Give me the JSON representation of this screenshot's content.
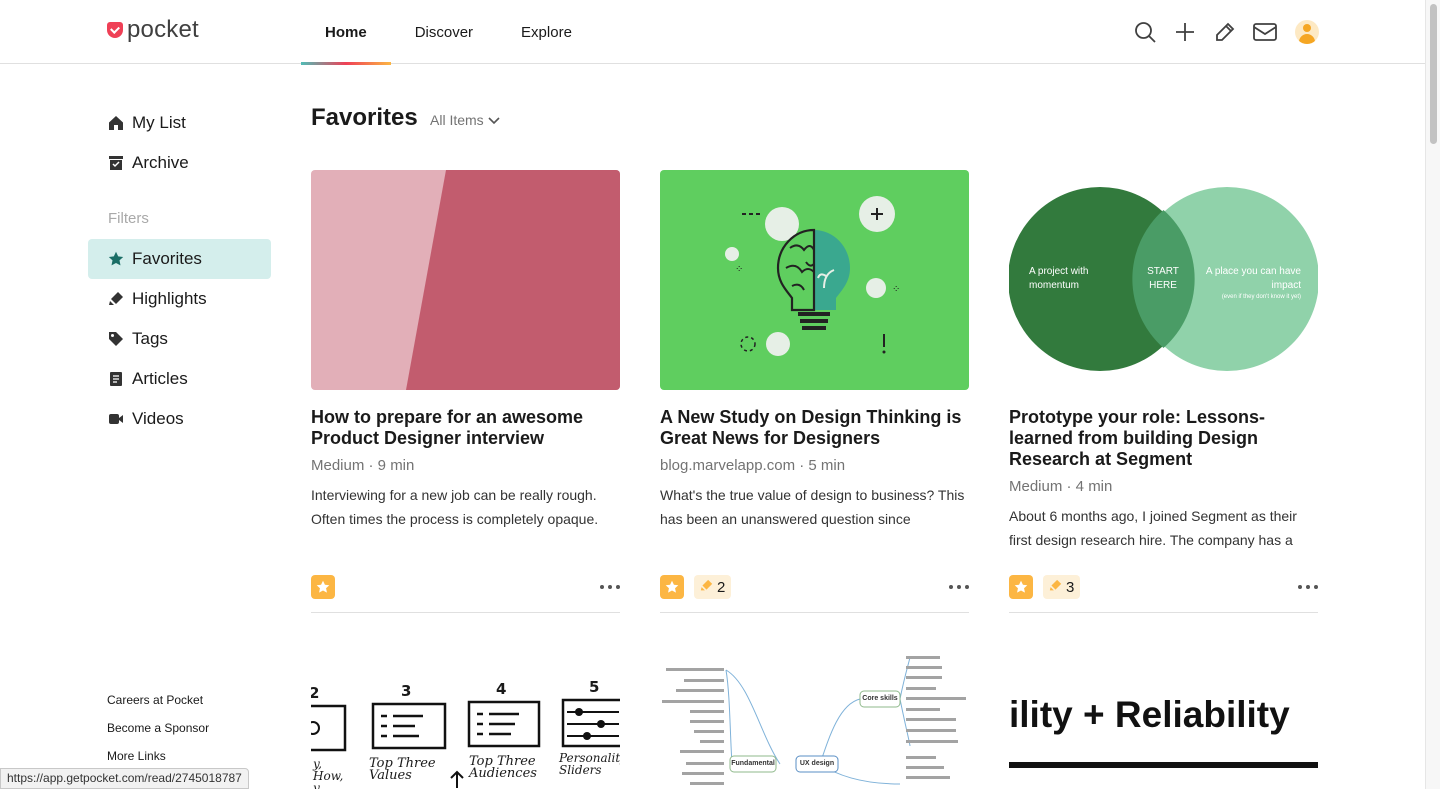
{
  "app": {
    "logo_text": "pocket",
    "brand_color": "#ef4056",
    "accent_color": "#50bcb6"
  },
  "nav": {
    "tabs": [
      {
        "label": "Home",
        "active": true
      },
      {
        "label": "Discover",
        "active": false
      },
      {
        "label": "Explore",
        "active": false
      }
    ]
  },
  "header_icons": [
    "search-icon",
    "add-icon",
    "pencil-icon",
    "inbox-icon",
    "avatar"
  ],
  "sidebar": {
    "items": [
      {
        "label": "My List",
        "icon": "home-icon"
      },
      {
        "label": "Archive",
        "icon": "archive-icon"
      }
    ],
    "filters_heading": "Filters",
    "filters": [
      {
        "label": "Favorites",
        "icon": "star-icon",
        "active": true
      },
      {
        "label": "Highlights",
        "icon": "highlighter-icon"
      },
      {
        "label": "Tags",
        "icon": "tag-icon"
      },
      {
        "label": "Articles",
        "icon": "article-icon"
      },
      {
        "label": "Videos",
        "icon": "video-icon"
      }
    ],
    "footer_links": [
      "Careers at Pocket",
      "Become a Sponsor",
      "More Links"
    ]
  },
  "main": {
    "title": "Favorites",
    "filter_label": "All Items",
    "cards": [
      {
        "title": "How to prepare for an awesome Product Designer interview",
        "meta": "Medium · 9 min",
        "excerpt": "Interviewing for a new job can be really rough. Often times the process is completely opaque.",
        "favorited": true,
        "highlights": null
      },
      {
        "title": "A New Study on Design Thinking is Great News for Designers",
        "meta": "blog.marvelapp.com · 5 min",
        "excerpt": "What's the true value of design to business? This has been an unanswered question since",
        "favorited": true,
        "highlights": "2"
      },
      {
        "title": "Prototype your role: Lessons-learned from building Design Research at Segment",
        "meta": "Medium · 4 min",
        "excerpt": "About 6 months ago, I joined Segment as their first design research hire. The company has a",
        "favorited": true,
        "highlights": "3",
        "image_text": {
          "left": "A project with momentum",
          "center": "START HERE",
          "right": "A place you can have impact",
          "right_small": "(even if they don't know it yet)"
        }
      }
    ],
    "row2": {
      "sketch_labels": [
        "2",
        "3",
        "4",
        "5"
      ],
      "sketch_captions": [
        "Top Three Values",
        "Top Three Audiences",
        "Personality Sliders",
        "y, How, y"
      ],
      "mindmap_center": "UX design",
      "mindmap_left": "Fundamental",
      "mindmap_right": "Core skills",
      "banner_text": "ility + Reliability"
    }
  },
  "status_url": "https://app.getpocket.com/read/2745018787"
}
